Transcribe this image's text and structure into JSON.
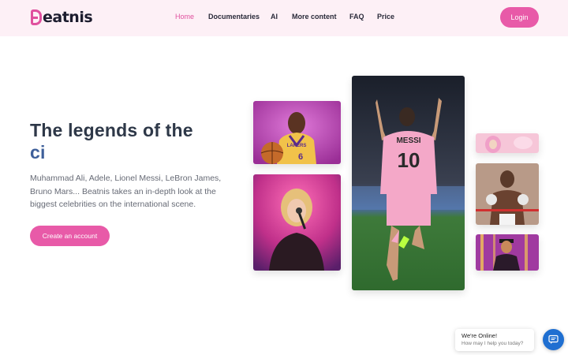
{
  "brand": {
    "name": "eatnis",
    "accent_color": "#e0509e"
  },
  "nav": {
    "items": [
      {
        "label": "Home",
        "active": true
      },
      {
        "label": "Documentaries",
        "active": false
      },
      {
        "label": "AI",
        "active": false
      },
      {
        "label": "More content",
        "active": false
      },
      {
        "label": "FAQ",
        "active": false
      },
      {
        "label": "Price",
        "active": false
      }
    ],
    "login_label": "Login"
  },
  "hero": {
    "title_line1": "The legends of the",
    "title_line2": "ci",
    "description": "Muhammad Ali, Adele, Lionel Messi, LeBron James, Bruno Mars... Beatnis takes an in-depth look at the biggest celebrities on the international scene.",
    "cta_label": "Create an account"
  },
  "photos": {
    "lebron": {
      "jersey_text": "LAKERS",
      "jersey_number": "6"
    },
    "messi": {
      "jersey_text": "MESSI",
      "jersey_number": "10"
    }
  },
  "chat": {
    "title": "We're Online!",
    "subtitle": "How may I help you today?",
    "icon": "chat-icon",
    "button_color": "#1f6fd1"
  }
}
